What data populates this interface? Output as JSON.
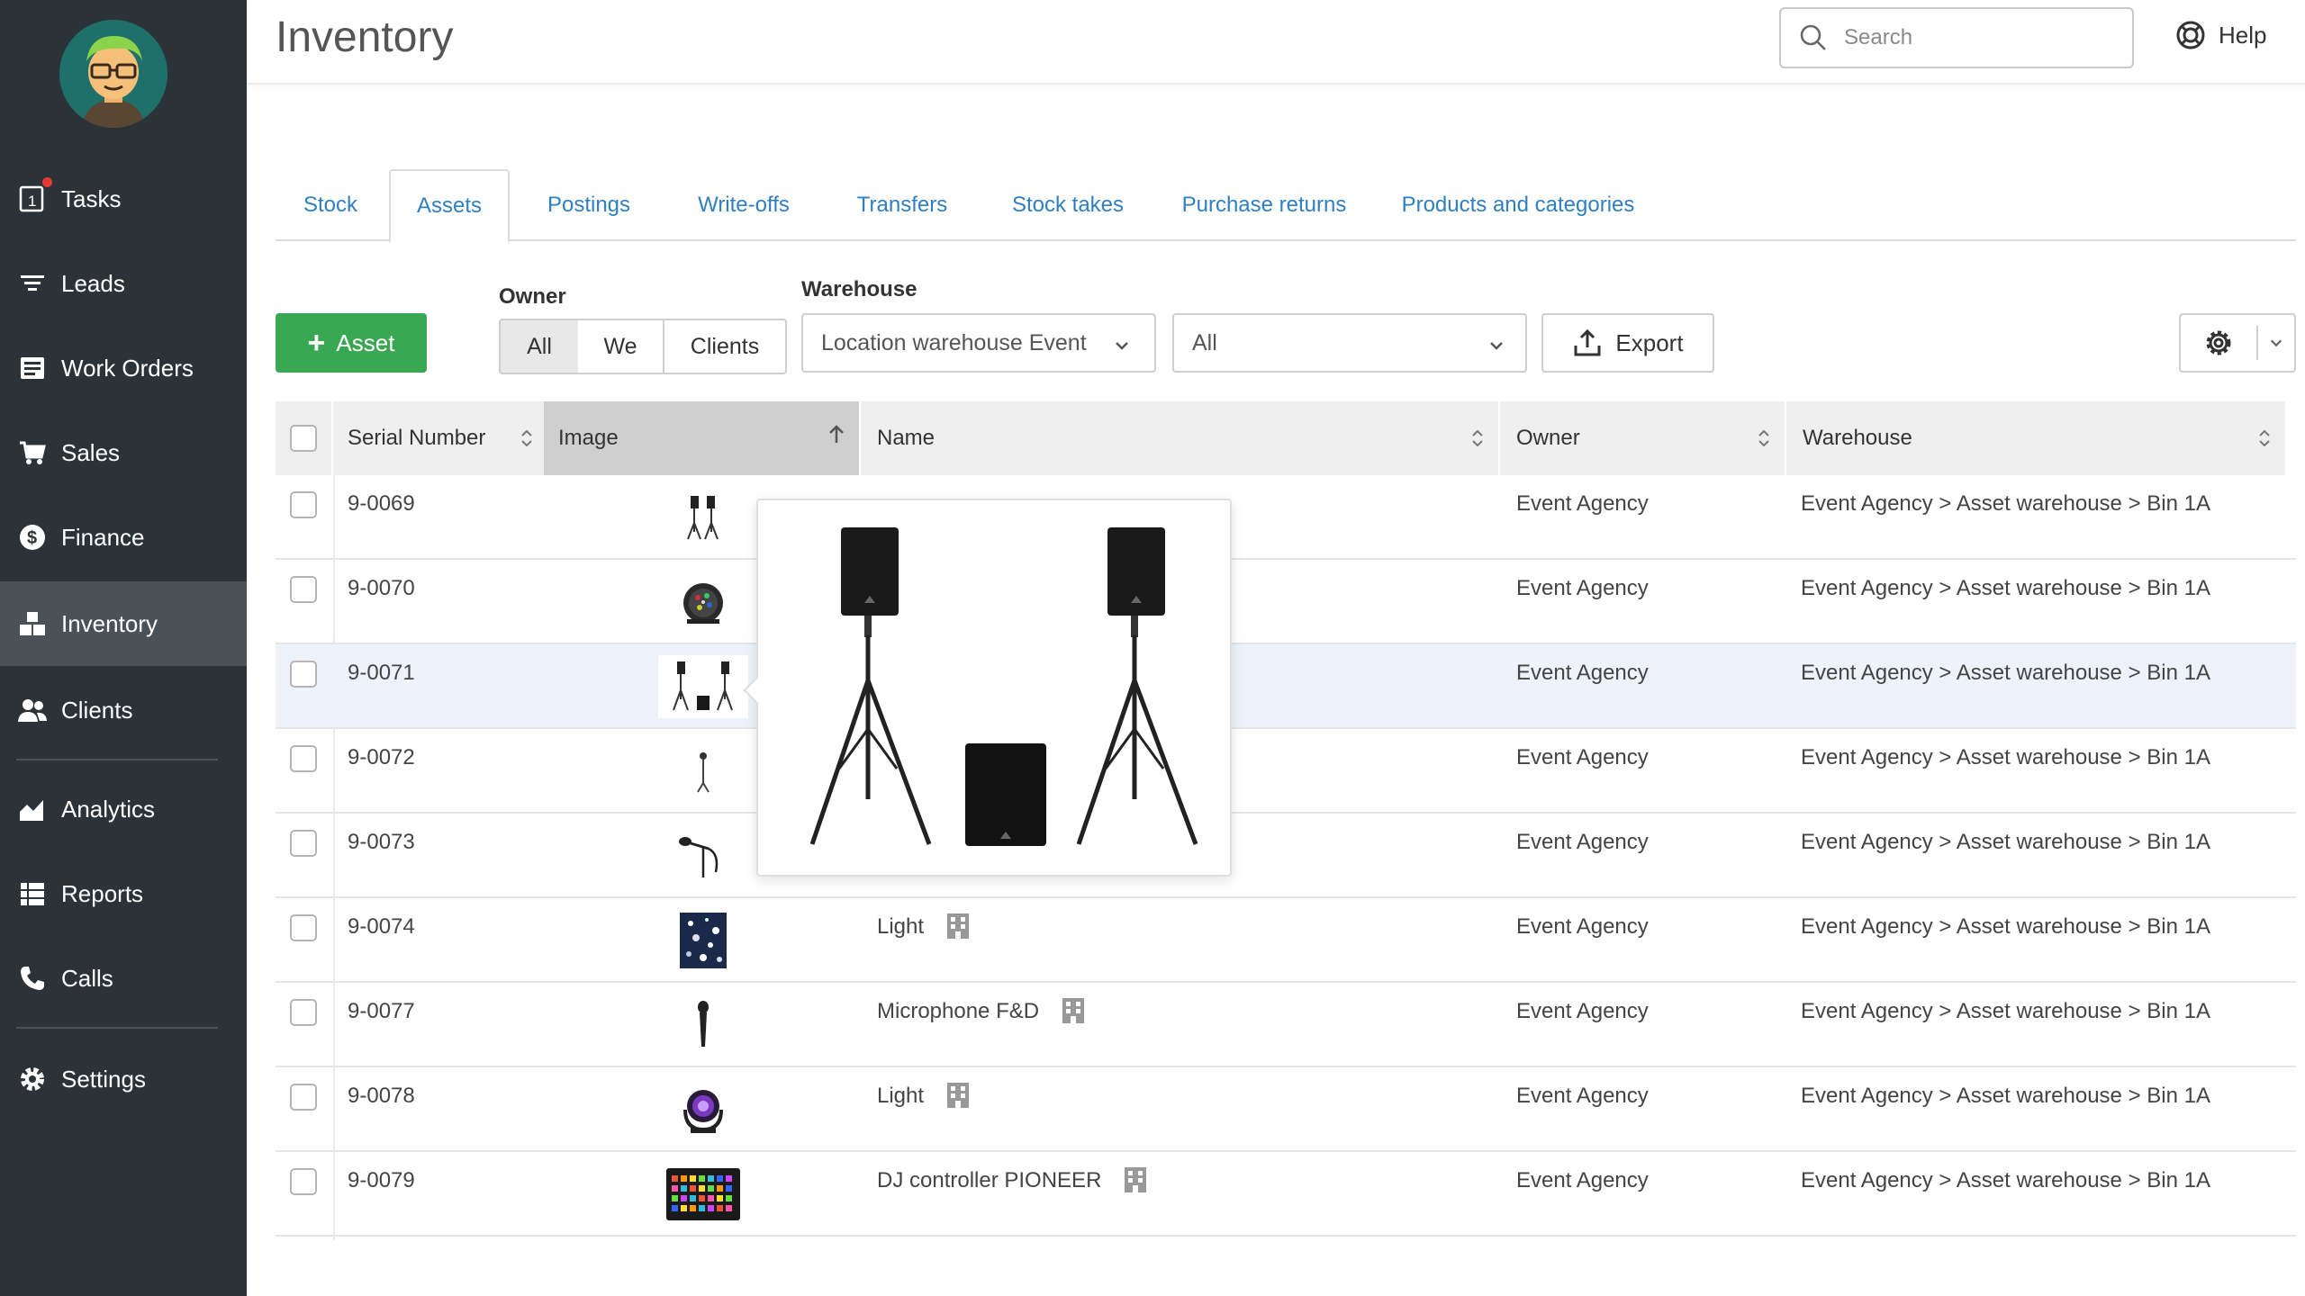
{
  "app": {
    "page_title": "Inventory",
    "search_placeholder": "Search",
    "help_label": "Help"
  },
  "sidebar": {
    "items": [
      {
        "label": "Tasks",
        "icon": "tasks-icon",
        "badge": "1"
      },
      {
        "label": "Leads",
        "icon": "funnel-icon"
      },
      {
        "label": "Work Orders",
        "icon": "work-orders-icon"
      },
      {
        "label": "Sales",
        "icon": "cart-icon"
      },
      {
        "label": "Finance",
        "icon": "dollar-icon"
      },
      {
        "label": "Inventory",
        "icon": "inventory-icon",
        "active": true
      },
      {
        "label": "Clients",
        "icon": "clients-icon"
      },
      {
        "label": "Analytics",
        "icon": "analytics-icon"
      },
      {
        "label": "Reports",
        "icon": "reports-icon"
      },
      {
        "label": "Calls",
        "icon": "phone-icon"
      },
      {
        "label": "Settings",
        "icon": "gear-icon"
      }
    ]
  },
  "tabs": [
    {
      "label": "Stock"
    },
    {
      "label": "Assets",
      "active": true
    },
    {
      "label": "Postings"
    },
    {
      "label": "Write-offs"
    },
    {
      "label": "Transfers"
    },
    {
      "label": "Stock takes"
    },
    {
      "label": "Purchase returns"
    },
    {
      "label": "Products and categories"
    }
  ],
  "toolbar": {
    "add_asset_label": "Asset",
    "owner_label": "Owner",
    "owner_options": [
      "All",
      "We",
      "Clients"
    ],
    "owner_selected": "All",
    "warehouse_label": "Warehouse",
    "warehouse_value": "Location warehouse Event",
    "bin_value": "All",
    "export_label": "Export"
  },
  "table": {
    "columns": [
      "Serial Number",
      "Image",
      "Name",
      "Owner",
      "Warehouse"
    ],
    "sorted_column": "Image",
    "rows": [
      {
        "serial": "9-0069",
        "image": "speaker-stands-thumb",
        "name": "",
        "owner": "Event Agency",
        "warehouse": "Event Agency > Asset warehouse > Bin 1A"
      },
      {
        "serial": "9-0070",
        "image": "par-light-thumb",
        "name": "",
        "owner": "Event Agency",
        "warehouse": "Event Agency > Asset warehouse > Bin 1A"
      },
      {
        "serial": "9-0071",
        "image": "pa-system-thumb",
        "name": "",
        "owner": "Event Agency",
        "warehouse": "Event Agency > Asset warehouse > Bin 1A",
        "hovered": true
      },
      {
        "serial": "9-0072",
        "image": "stand-thumb",
        "name": "",
        "owner": "Event Agency",
        "warehouse": "Event Agency > Asset warehouse > Bin 1A"
      },
      {
        "serial": "9-0073",
        "image": "mic-stand-thumb",
        "name": "",
        "owner": "Event Agency",
        "warehouse": "Event Agency > Asset warehouse > Bin 1A"
      },
      {
        "serial": "9-0074",
        "image": "light-effect-thumb",
        "name": "Light",
        "owner": "Event Agency",
        "warehouse": "Event Agency > Asset warehouse > Bin 1A"
      },
      {
        "serial": "9-0077",
        "image": "microphone-thumb",
        "name": "Microphone F&D",
        "owner": "Event Agency",
        "warehouse": "Event Agency > Asset warehouse > Bin 1A"
      },
      {
        "serial": "9-0078",
        "image": "moving-head-thumb",
        "name": "Light",
        "owner": "Event Agency",
        "warehouse": "Event Agency > Asset warehouse > Bin 1A"
      },
      {
        "serial": "9-0079",
        "image": "dj-controller-thumb",
        "name": "DJ controller PIONEER",
        "owner": "Event Agency",
        "warehouse": "Event Agency > Asset warehouse > Bin 1A"
      }
    ]
  },
  "popover": {
    "image": "pa-system-preview"
  }
}
